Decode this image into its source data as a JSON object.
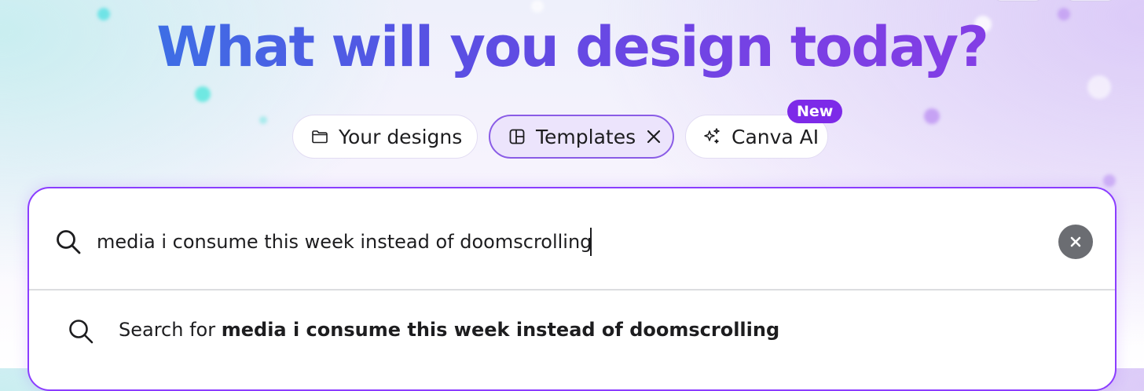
{
  "headline": "What will you design today?",
  "tabs": [
    {
      "label": "Your designs",
      "icon": "folder-icon",
      "active": false
    },
    {
      "label": "Templates",
      "icon": "template-icon",
      "active": true
    },
    {
      "label": "Canva AI",
      "icon": "sparkle-icon",
      "active": false,
      "badge": "New"
    }
  ],
  "search": {
    "value": "media i consume this week instead of doomscrolling",
    "clear_icon": "clear-icon"
  },
  "suggestion": {
    "prefix": "Search for",
    "query": "media i consume this week instead of doomscrolling"
  },
  "colors": {
    "accent": "#8b3dff",
    "badge": "#7d2ae8",
    "headline_start": "#2f7ee6",
    "headline_end": "#8b3ee6"
  }
}
